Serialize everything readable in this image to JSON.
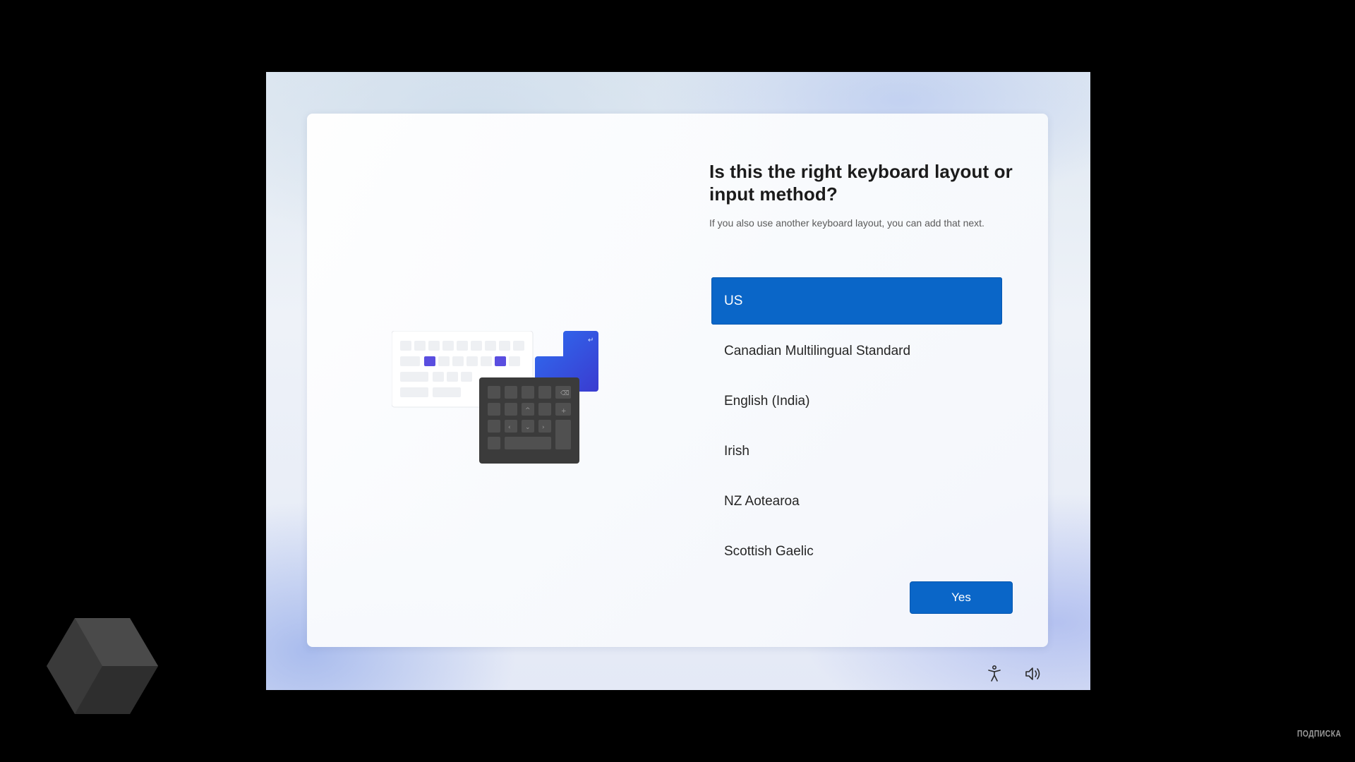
{
  "setup": {
    "title": "Is this the right keyboard layout or input method?",
    "subtitle": "If you also use another keyboard layout, you can add that next.",
    "layouts": [
      {
        "label": "US",
        "selected": true
      },
      {
        "label": "Canadian Multilingual Standard",
        "selected": false
      },
      {
        "label": "English (India)",
        "selected": false
      },
      {
        "label": "Irish",
        "selected": false
      },
      {
        "label": "NZ Aotearoa",
        "selected": false
      },
      {
        "label": "Scottish Gaelic",
        "selected": false
      }
    ],
    "yes_label": "Yes"
  },
  "footer_icons": [
    "accessibility-icon",
    "volume-icon"
  ],
  "overlay": {
    "watermark": "ПОДПИСКА",
    "logo_icon": "hexagon-logo"
  },
  "colors": {
    "accent": "#0a66c8",
    "background": "#000000"
  }
}
